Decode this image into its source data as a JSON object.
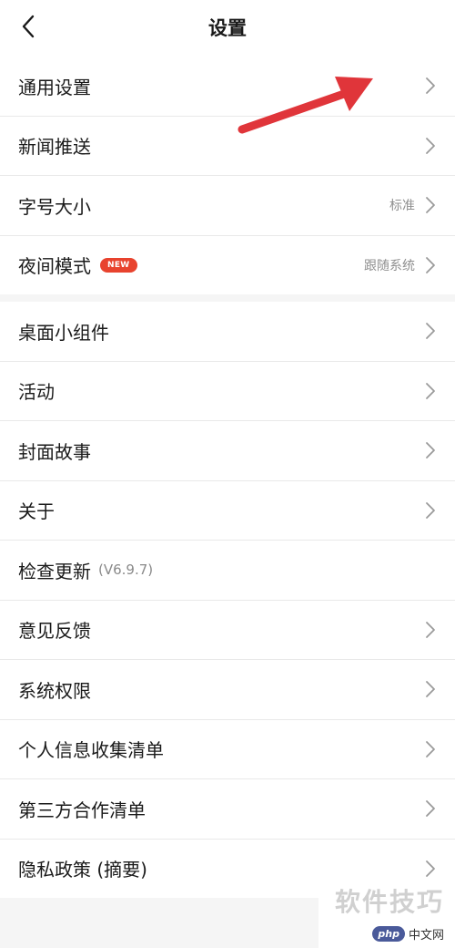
{
  "header": {
    "title": "设置",
    "back_icon": "chevron-left-icon"
  },
  "groups": [
    {
      "items": [
        {
          "label": "通用设置",
          "value": "",
          "badge": "",
          "version": ""
        },
        {
          "label": "新闻推送",
          "value": "",
          "badge": "",
          "version": ""
        },
        {
          "label": "字号大小",
          "value": "标准",
          "badge": "",
          "version": ""
        },
        {
          "label": "夜间模式",
          "value": "跟随系统",
          "badge": "NEW",
          "version": ""
        }
      ]
    },
    {
      "items": [
        {
          "label": "桌面小组件",
          "value": "",
          "badge": "",
          "version": ""
        },
        {
          "label": "活动",
          "value": "",
          "badge": "",
          "version": ""
        },
        {
          "label": "封面故事",
          "value": "",
          "badge": "",
          "version": ""
        },
        {
          "label": "关于",
          "value": "",
          "badge": "",
          "version": ""
        },
        {
          "label": "检查更新",
          "value": "",
          "badge": "",
          "version": "(V6.9.7)"
        },
        {
          "label": "意见反馈",
          "value": "",
          "badge": "",
          "version": ""
        },
        {
          "label": "系统权限",
          "value": "",
          "badge": "",
          "version": ""
        },
        {
          "label": "个人信息收集清单",
          "value": "",
          "badge": "",
          "version": ""
        },
        {
          "label": "第三方合作清单",
          "value": "",
          "badge": "",
          "version": ""
        },
        {
          "label": "隐私政策 (摘要)",
          "value": "",
          "badge": "",
          "version": ""
        }
      ]
    }
  ],
  "annotation": {
    "icon": "red-arrow-icon",
    "color": "#e0353a"
  },
  "watermark": {
    "text": "软件技巧",
    "logo_badge": "php",
    "logo_text": "中文网"
  },
  "colors": {
    "badge_new": "#e8432e",
    "chevron": "#9a9a9a",
    "background": "#f5f5f5"
  }
}
